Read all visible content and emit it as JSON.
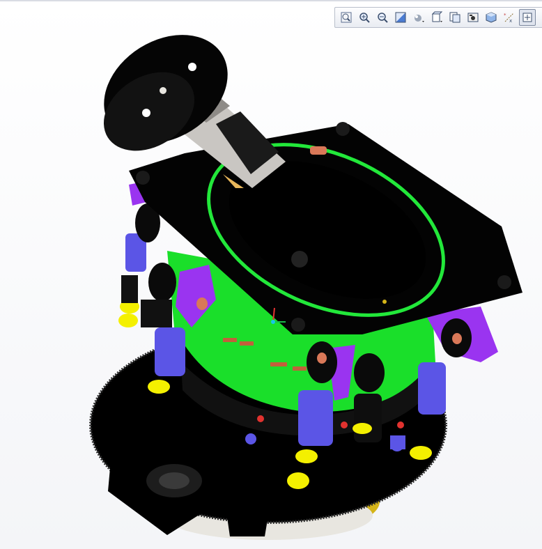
{
  "viewer": {
    "toolbar": {
      "buttons": [
        {
          "id": "zoom-fit",
          "icon": "zoom-fit-icon"
        },
        {
          "id": "zoom-in",
          "icon": "zoom-in-icon"
        },
        {
          "id": "zoom-out",
          "icon": "zoom-out-icon"
        },
        {
          "id": "repaint",
          "icon": "repaint-icon"
        },
        {
          "id": "display-style",
          "icon": "display-style-icon"
        },
        {
          "id": "saved-views",
          "icon": "saved-views-icon"
        },
        {
          "id": "view-manager",
          "icon": "view-manager-icon"
        },
        {
          "id": "section",
          "icon": "section-camera-icon"
        },
        {
          "id": "orient",
          "icon": "orient-cube-icon"
        },
        {
          "id": "datum-display",
          "icon": "datum-display-icon"
        },
        {
          "id": "spin-center",
          "icon": "spin-center-icon",
          "active": true
        }
      ]
    },
    "model": {
      "icon": "cad-assembly-model",
      "colors": {
        "body": "#000000",
        "ring": "#22e83a",
        "band": "#1adf2a",
        "actuator": "#5b55e6",
        "collar": "#f4f000",
        "clamp": "#9a34f0",
        "spring": "#d97858",
        "base": "#d4b418",
        "shaft": "#c9c6c2"
      }
    }
  }
}
